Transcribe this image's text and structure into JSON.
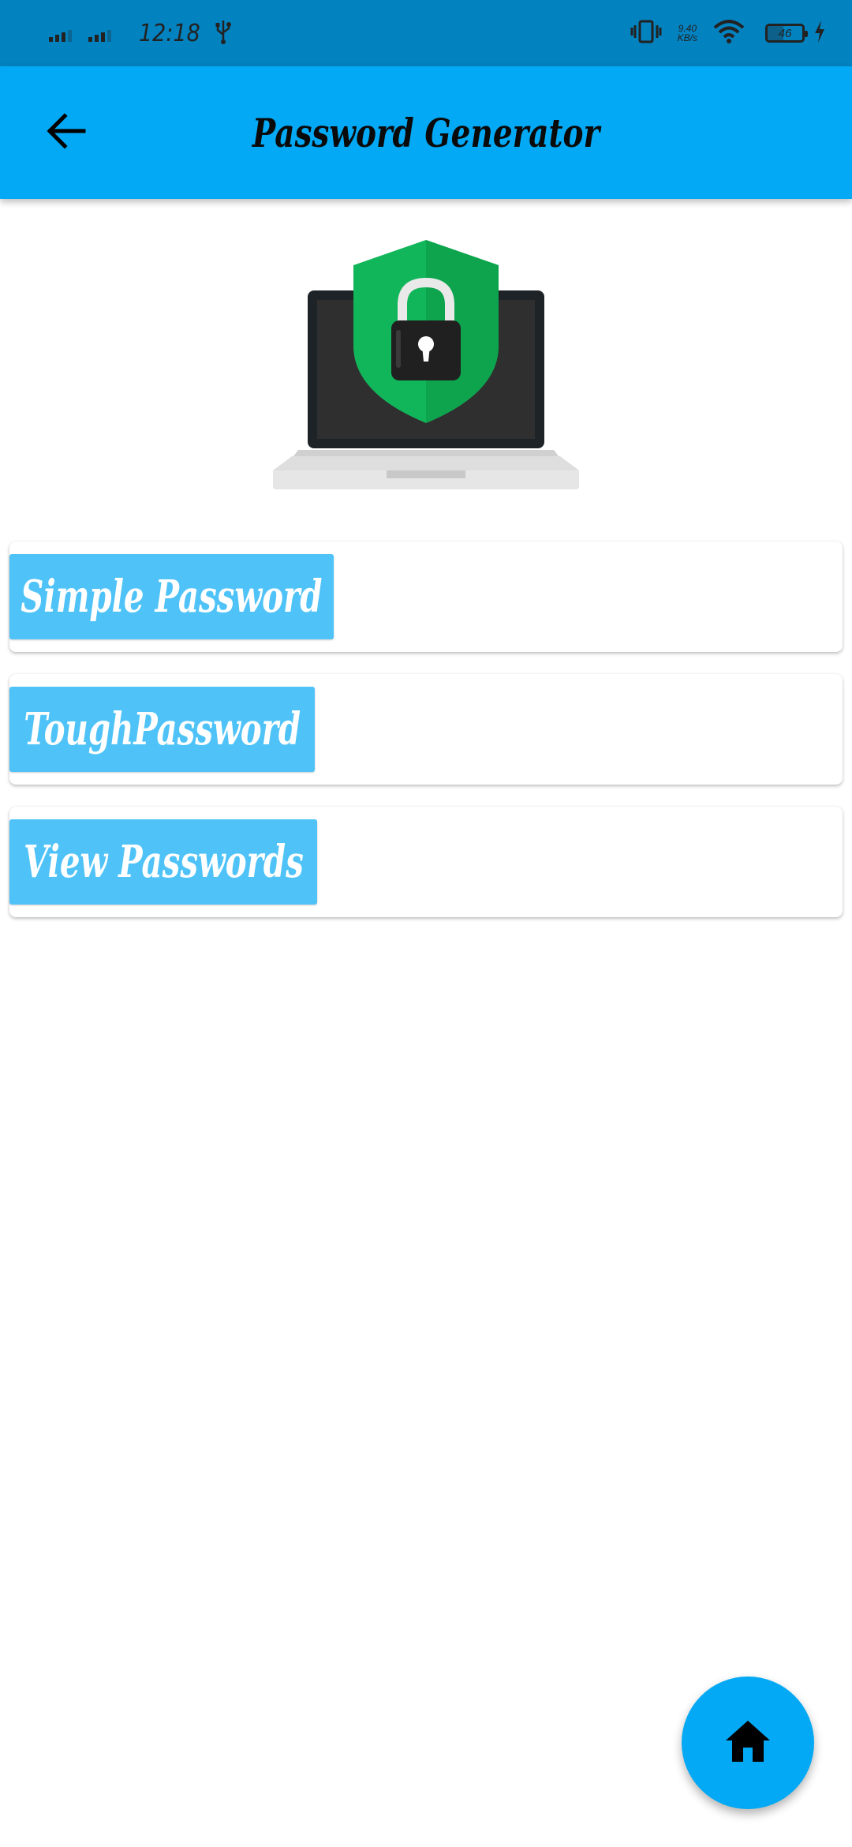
{
  "status_bar": {
    "time": "12:18",
    "net_speed_value": "9.40",
    "net_speed_unit": "KB/s",
    "battery_level": "46",
    "icons": [
      "signal-icon",
      "signal-icon",
      "usb-icon",
      "vibrate-icon",
      "wifi-icon",
      "battery-icon",
      "charging-icon"
    ]
  },
  "app_bar": {
    "title": "Password Generator",
    "back_icon": "arrow-back-icon"
  },
  "hero": {
    "image": "laptop-shield-lock-illustration"
  },
  "menu": {
    "items": [
      {
        "label": "Simple Password"
      },
      {
        "label": "ToughPassword"
      },
      {
        "label": "View Passwords"
      }
    ]
  },
  "fab": {
    "icon": "home-icon"
  },
  "colors": {
    "status_bar": "#0382c0",
    "app_bar": "#03a9f4",
    "button": "#4fc3f7",
    "fab": "#03a9f4",
    "shield_green": "#12b65a"
  }
}
